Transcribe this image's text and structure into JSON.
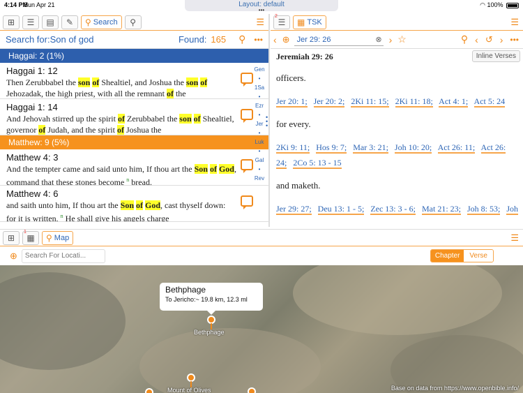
{
  "status": {
    "time": "4:14 PM",
    "date": "Sun Apr 21",
    "layout": "Layout: default",
    "dots": "•••",
    "battery": "100%"
  },
  "left": {
    "search_tab": "Search",
    "search_for": "Search for:Son of god",
    "found_label": "Found:",
    "found_count": "165",
    "groups": [
      {
        "title": "Haggai: 2 (1%)",
        "color": "#2d5fad"
      },
      {
        "title": "Matthew: 9 (5%)",
        "color": "#f6921e"
      }
    ],
    "verses": [
      {
        "ref": "Haggai 1: 12",
        "segs": [
          [
            "Then Zerubbabel the ",
            0
          ],
          [
            "son",
            1
          ],
          [
            " ",
            0
          ],
          [
            "of",
            1
          ],
          [
            " Shealtiel, and Joshua the ",
            0
          ],
          [
            "son",
            1
          ],
          [
            " ",
            0
          ],
          [
            "of",
            1
          ],
          [
            " Jehozadak, the high priest, with all the remnant ",
            0
          ],
          [
            "of",
            1
          ],
          [
            " the",
            0
          ]
        ]
      },
      {
        "ref": "Haggai 1: 14",
        "segs": [
          [
            "And Jehovah stirred up the spirit ",
            0
          ],
          [
            "of",
            1
          ],
          [
            " Zerubbabel the ",
            0
          ],
          [
            "son",
            1
          ],
          [
            " ",
            0
          ],
          [
            "of",
            1
          ],
          [
            " Shealtiel, governor ",
            0
          ],
          [
            "of",
            1
          ],
          [
            " Judah, and the spirit ",
            0
          ],
          [
            "of",
            1
          ],
          [
            " Joshua the",
            0
          ]
        ]
      },
      {
        "ref": "Matthew 4: 3",
        "segs": [
          [
            "And the tempter came and said unto him, If thou art the ",
            0
          ],
          [
            "Son",
            1
          ],
          [
            " ",
            0
          ],
          [
            "of",
            1
          ],
          [
            " ",
            0
          ],
          [
            "God",
            1
          ],
          [
            ", command that these stones become ",
            0
          ],
          [
            "n",
            2
          ],
          [
            " bread.",
            0
          ]
        ]
      },
      {
        "ref": "Matthew 4: 6",
        "segs": [
          [
            "and saith unto him, If thou art the ",
            0
          ],
          [
            "Son",
            1
          ],
          [
            " ",
            0
          ],
          [
            "of",
            1
          ],
          [
            " ",
            0
          ],
          [
            "God",
            1
          ],
          [
            ", cast thyself down: for it is written, ",
            0
          ],
          [
            "n",
            2
          ],
          [
            " He shall give his angels charge",
            0
          ]
        ]
      }
    ],
    "index": [
      "Gen",
      "•",
      "1Sa",
      "•",
      "Ezr",
      "•",
      "Jer",
      "•",
      "Luk",
      "•",
      "Gal",
      "•",
      "Rev"
    ]
  },
  "right": {
    "tab": "TSK",
    "ref_input": "Jer 29: 26",
    "heading": "Jeremiah 29: 26",
    "inline_btn": "Inline Verses",
    "texts": [
      "officers.",
      "for every.",
      "and maketh."
    ],
    "links1": [
      "Jer 20: 1;",
      "Jer 20: 2;",
      "2Ki 11: 15;",
      "2Ki 11: 18;",
      "Act 4: 1;",
      "Act 5: 24"
    ],
    "links2": [
      "2Ki 9: 11;",
      "Hos 9: 7;",
      "Mar 3: 21;",
      "Joh 10: 20;",
      "Act 26: 11;",
      "Act 26: 24;",
      "2Co 5: 13 - 15"
    ],
    "links3": [
      "Jer 29: 27;",
      "Deu 13: 1 - 5;",
      "Zec 13: 3 - 6;",
      "Mat 21: 23;",
      "Joh 8: 53;",
      "Joh"
    ]
  },
  "map": {
    "tab": "Map",
    "search_placeholder": "Search For Locati...",
    "chapter_btn": "Chapter",
    "verse_btn": "Verse",
    "popup_title": "Bethphage",
    "popup_sub": "To Jericho:~ 19.8 km, 12.3 ml",
    "pin_label": "Bethphage",
    "pin2_label": "Mount of Olives",
    "credit": "Base on data from  https://www.openbible.info/"
  }
}
